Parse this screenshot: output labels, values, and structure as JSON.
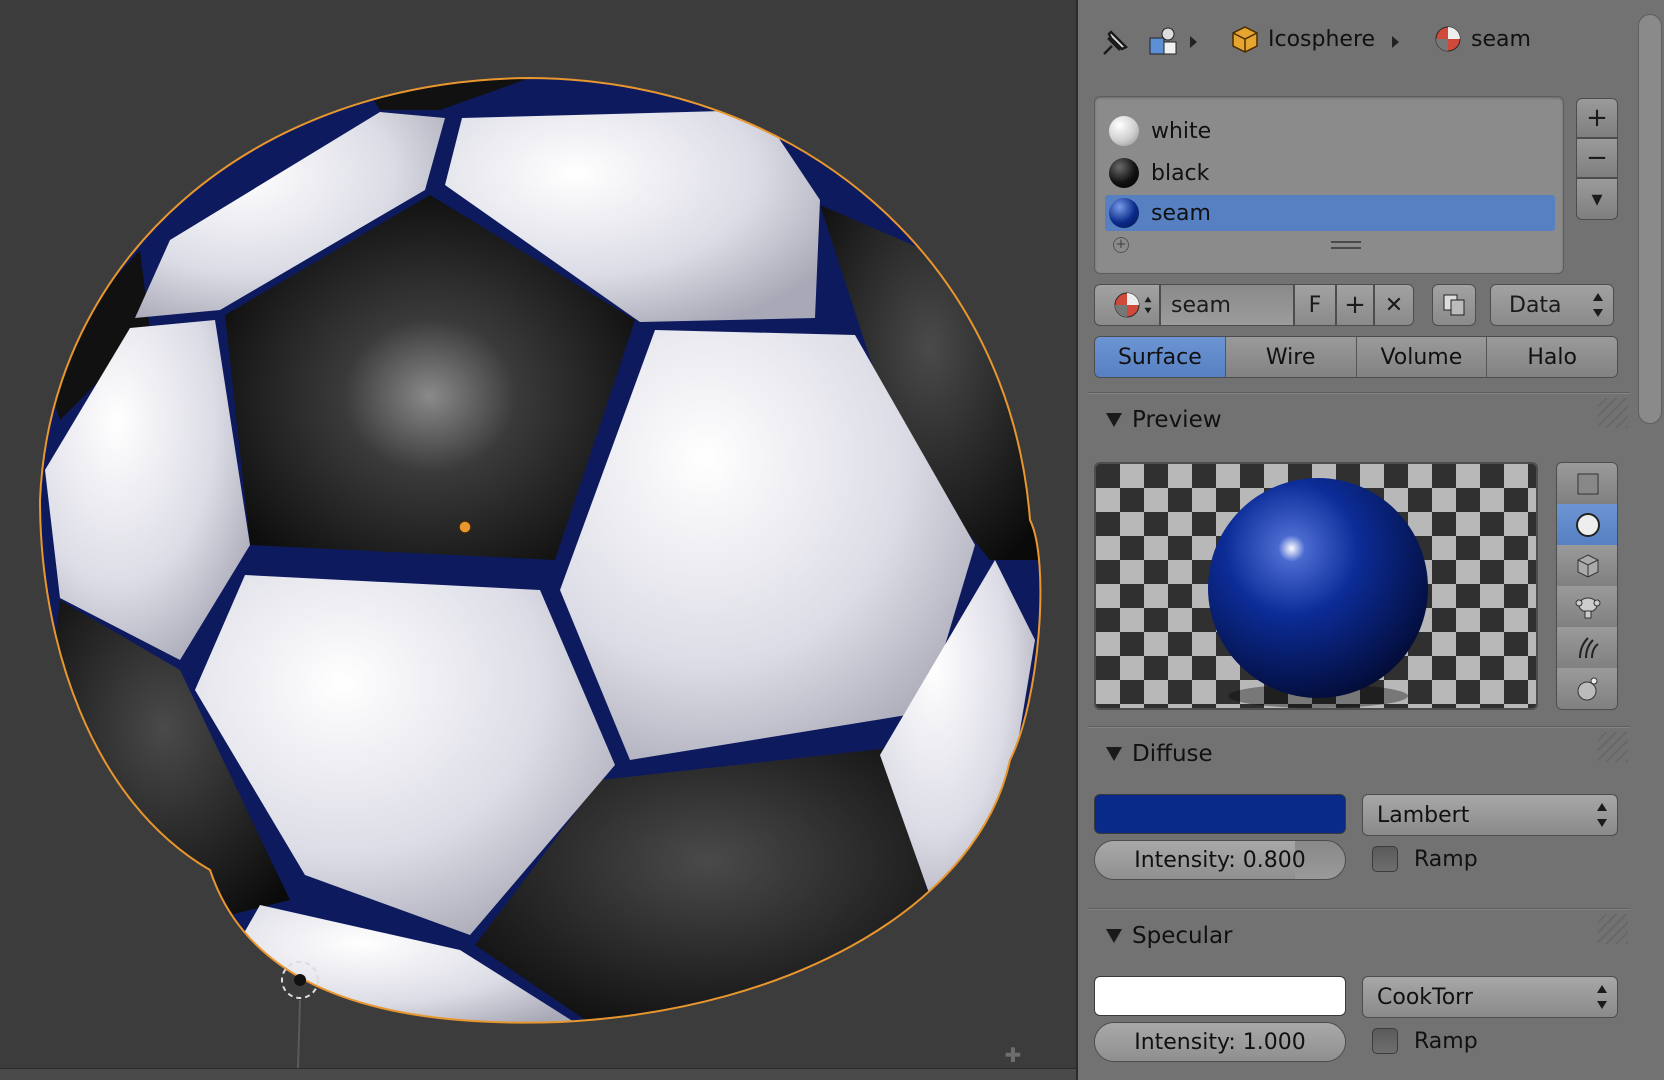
{
  "header": {
    "object_name": "Icosphere",
    "material_name": "seam"
  },
  "material_slots": [
    {
      "name": "white",
      "color": "#f0f0f0",
      "selected": false
    },
    {
      "name": "black",
      "color": "#101010",
      "selected": false
    },
    {
      "name": "seam",
      "color": "#0a2a8a",
      "selected": true
    }
  ],
  "slot_buttons": {
    "add": "+",
    "remove": "−",
    "menu": "▾"
  },
  "datablock": {
    "name": "seam",
    "fake_user": "F",
    "add": "+",
    "unlink": "✕",
    "link": "Data"
  },
  "tabs": [
    {
      "label": "Surface",
      "active": true
    },
    {
      "label": "Wire",
      "active": false
    },
    {
      "label": "Volume",
      "active": false
    },
    {
      "label": "Halo",
      "active": false
    }
  ],
  "sections": {
    "preview": "Preview",
    "diffuse": "Diffuse",
    "specular": "Specular"
  },
  "preview_types": [
    "flat-plane-icon",
    "sphere-icon",
    "cube-icon",
    "monkey-icon",
    "hair-icon",
    "sky-sphere-icon"
  ],
  "diffuse": {
    "color": "#0a2a8a",
    "shader": "Lambert",
    "intensity_label": "Intensity: 0.800",
    "intensity": 0.8,
    "ramp_label": "Ramp"
  },
  "specular": {
    "color": "#ffffff",
    "shader": "CookTorr",
    "intensity_label": "Intensity: 1.000",
    "intensity": 1.0,
    "ramp_label": "Ramp"
  },
  "colors": {
    "selection_blue": "#5680c2",
    "seam_blue": "#0a2a8a",
    "outline_orange": "#e8962e"
  }
}
